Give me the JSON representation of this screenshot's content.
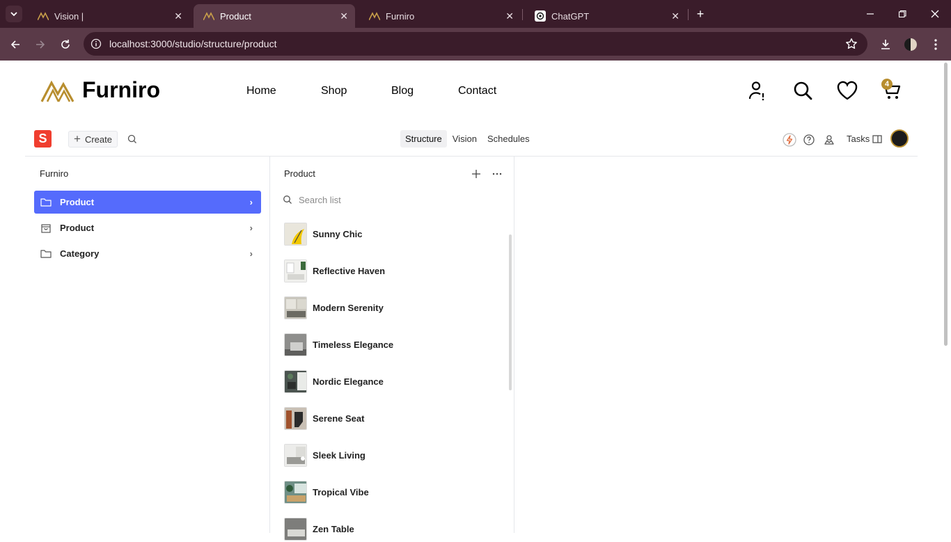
{
  "browser": {
    "tabs": [
      {
        "title": "Vision |",
        "icon": "furniro-icon"
      },
      {
        "title": "Product",
        "icon": "furniro-icon",
        "active": true
      },
      {
        "title": "Furniro",
        "icon": "furniro-icon"
      },
      {
        "title": "ChatGPT",
        "icon": "chatgpt-icon"
      }
    ],
    "url": "localhost:3000/studio/structure/product"
  },
  "site": {
    "logo_text": "Furniro",
    "nav": [
      "Home",
      "Shop",
      "Blog",
      "Contact"
    ],
    "cart_count": "4",
    "brand_color": "#b88e2f"
  },
  "studio": {
    "logo_letter": "S",
    "create_label": "Create",
    "tabs": [
      "Structure",
      "Vision",
      "Schedules"
    ],
    "active_tab": "Structure",
    "tasks_label": "Tasks",
    "accent": "#556bfc"
  },
  "pane1": {
    "title": "Furniro",
    "items": [
      {
        "label": "Product",
        "icon": "folder-icon",
        "selected": true
      },
      {
        "label": "Product",
        "icon": "bag-icon",
        "selected": false
      },
      {
        "label": "Category",
        "icon": "folder-icon",
        "selected": false
      }
    ]
  },
  "pane2": {
    "title": "Product",
    "search_placeholder": "Search list",
    "items": [
      {
        "name": "Sunny Chic"
      },
      {
        "name": "Reflective Haven"
      },
      {
        "name": "Modern Serenity"
      },
      {
        "name": "Timeless Elegance"
      },
      {
        "name": "Nordic Elegance"
      },
      {
        "name": "Serene Seat"
      },
      {
        "name": "Sleek Living"
      },
      {
        "name": "Tropical Vibe"
      },
      {
        "name": "Zen Table"
      }
    ]
  }
}
